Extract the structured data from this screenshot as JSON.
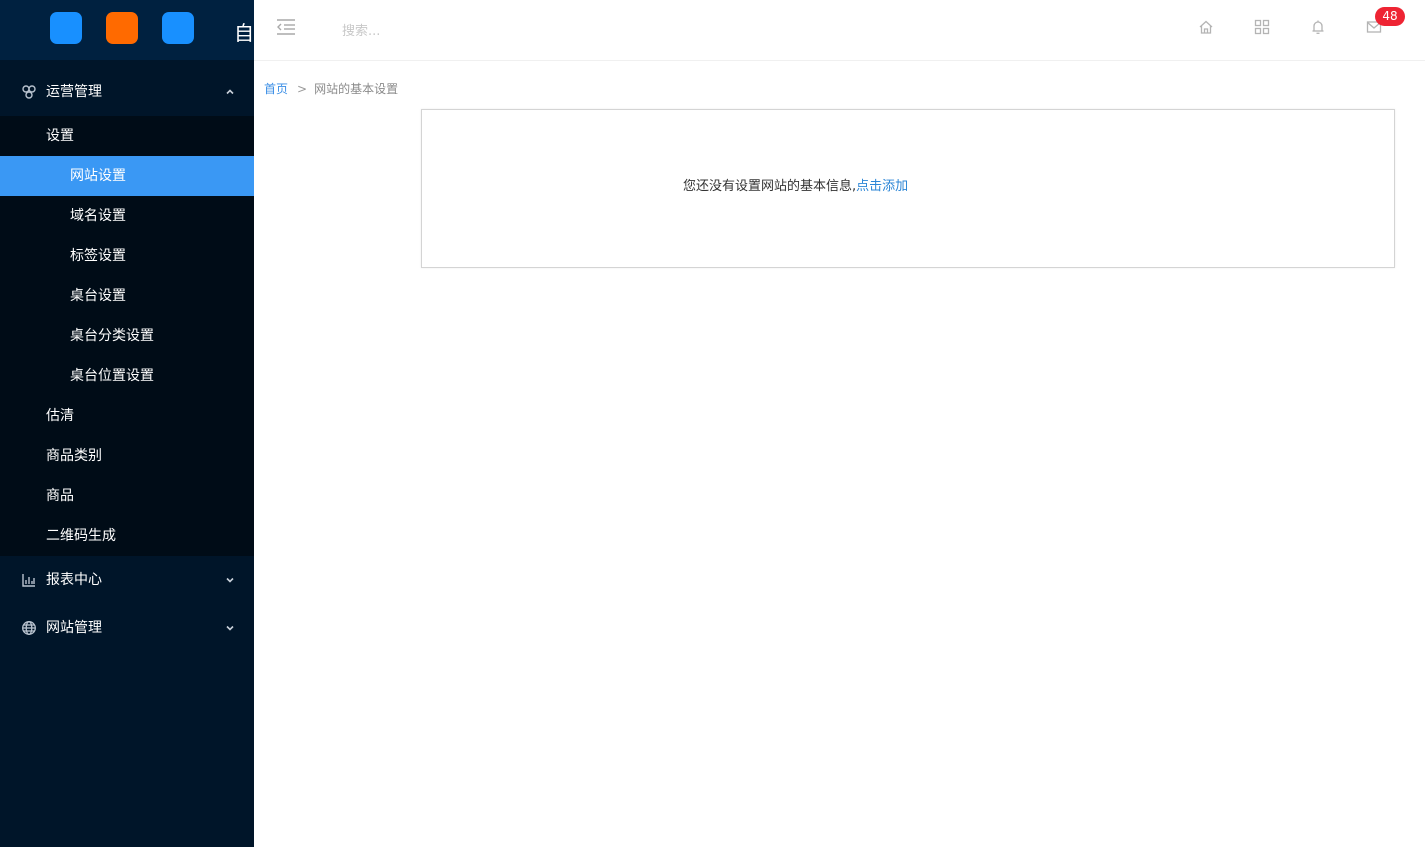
{
  "logo": {
    "text": "自"
  },
  "sidebar": {
    "groups": [
      {
        "label": "运营管理",
        "icon": "cluster-icon",
        "expanded": true,
        "items": [
          {
            "label": "设置",
            "children": [
              "网站设置",
              "域名设置",
              "标签设置",
              "桌台设置",
              "桌台分类设置",
              "桌台位置设置"
            ]
          },
          {
            "label": "估清"
          },
          {
            "label": "商品类别"
          },
          {
            "label": "商品"
          },
          {
            "label": "二维码生成"
          }
        ]
      },
      {
        "label": "报表中心",
        "icon": "bar-chart-icon",
        "expanded": false
      },
      {
        "label": "网站管理",
        "icon": "globe-icon",
        "expanded": false
      }
    ],
    "active_item": "网站设置"
  },
  "header": {
    "search_placeholder": "搜索...",
    "mail_badge": "48"
  },
  "breadcrumb": {
    "home": "首页",
    "separator": ">",
    "current": "网站的基本设置"
  },
  "panel": {
    "message": "您还没有设置网站的基本信息,",
    "link": "点击添加"
  },
  "colors": {
    "sidebar_bg": "#001529",
    "submenu_bg": "#000c17",
    "active_item": "#3a98f4",
    "badge": "#ee2433",
    "link": "#2c86d6"
  }
}
